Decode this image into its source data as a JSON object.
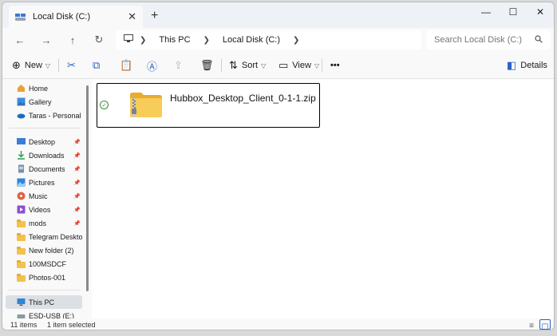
{
  "window": {
    "tab_title": "Local Disk (C:)",
    "tab_close": "✕",
    "new_tab": "+",
    "controls": {
      "minimize": "—",
      "maximize": "☐",
      "close": "✕"
    }
  },
  "address": {
    "back": "←",
    "forward": "→",
    "up": "↑",
    "refresh": "↻",
    "crumbs": [
      "This PC",
      "Local Disk (C:)"
    ],
    "search_placeholder": "Search Local Disk (C:)"
  },
  "toolbar": {
    "new_label": "New",
    "sort_label": "Sort",
    "view_label": "View",
    "more_label": "•••",
    "details_label": "Details"
  },
  "sidebar": {
    "items": [
      {
        "label": "Home",
        "icon": "home-icon"
      },
      {
        "label": "Gallery",
        "icon": "gallery-icon"
      },
      {
        "label": "Taras - Personal",
        "icon": "cloud-icon"
      },
      {
        "label": "Desktop",
        "icon": "desktop-icon"
      },
      {
        "label": "Downloads",
        "icon": "download-icon"
      },
      {
        "label": "Documents",
        "icon": "document-icon"
      },
      {
        "label": "Pictures",
        "icon": "pictures-icon"
      },
      {
        "label": "Music",
        "icon": "music-icon"
      },
      {
        "label": "Videos",
        "icon": "video-icon"
      },
      {
        "label": "mods",
        "icon": "folder-icon"
      },
      {
        "label": "Telegram Desktop",
        "icon": "folder-icon"
      },
      {
        "label": "New folder (2)",
        "icon": "folder-icon"
      },
      {
        "label": "100MSDCF",
        "icon": "folder-icon"
      },
      {
        "label": "Photos-001",
        "icon": "folder-icon"
      },
      {
        "label": "This PC",
        "icon": "pc-icon"
      },
      {
        "label": "ESD-USB (E:)",
        "icon": "usb-drive-icon"
      }
    ]
  },
  "content": {
    "files": [
      {
        "name": "Hubbox_Desktop_Client_0-1-1.zip",
        "icon": "zip-folder-icon",
        "status": "✓"
      }
    ]
  },
  "status": {
    "count": "11 items",
    "selection": "1 item selected"
  }
}
